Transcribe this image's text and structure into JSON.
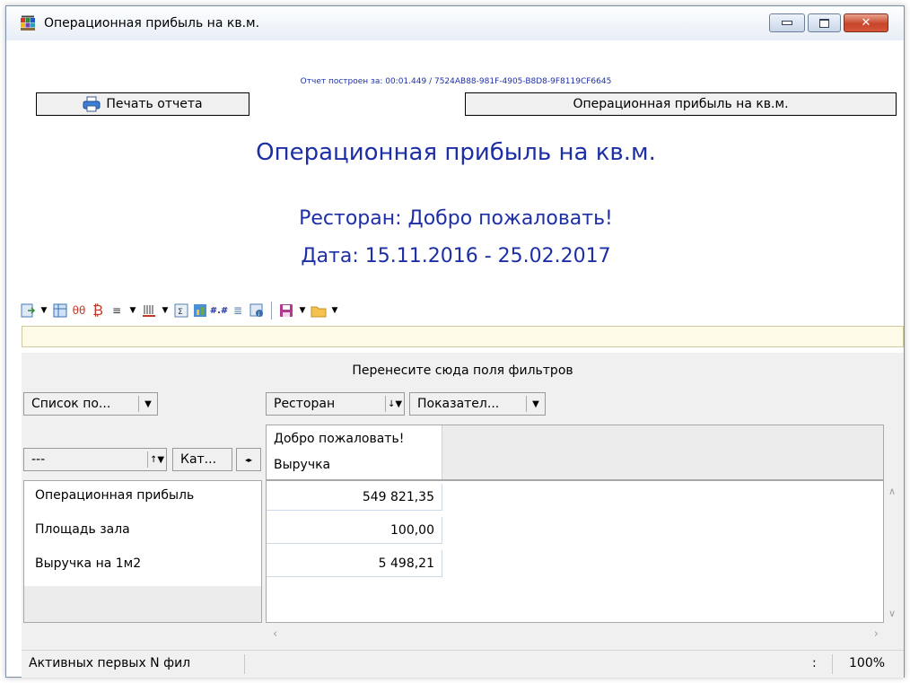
{
  "window": {
    "title": "Операционная прибыль на кв.м."
  },
  "report": {
    "meta": "Отчет построен за: 00:01.449 / 7524AB88-981F-4905-B8D8-9F8119CF6645",
    "print_button": "Печать отчета",
    "report_button": "Операционная прибыль на кв.м.",
    "heading": "Операционная прибыль на кв.м.",
    "restaurant_line": "Ресторан: Добро пожаловать!",
    "date_line": "Дата: 15.11.2016 - 25.02.2017"
  },
  "pivot": {
    "filter_hint": "Перенесите сюда поля фильтров",
    "fields": {
      "list": "Список по...",
      "restaurant": "Ресторан",
      "indicators": "Показател...",
      "row_field": "---",
      "category": "Кат..."
    },
    "column_header": {
      "restaurant": "Добро пожаловать!",
      "measure": "Выручка"
    },
    "rows": [
      {
        "label": "Операционная прибыль",
        "value": "549 821,35"
      },
      {
        "label": "Площадь зала",
        "value": "100,00"
      },
      {
        "label": "Выручка на 1м2",
        "value": "5 498,21"
      }
    ]
  },
  "status": {
    "text": "Активных первых N фил",
    "separator": ":",
    "zoom": "100%"
  },
  "colors": {
    "accent_text": "#1e2fa6",
    "close_button": "#c7462b",
    "filter_bar": "#fdfbe8"
  }
}
